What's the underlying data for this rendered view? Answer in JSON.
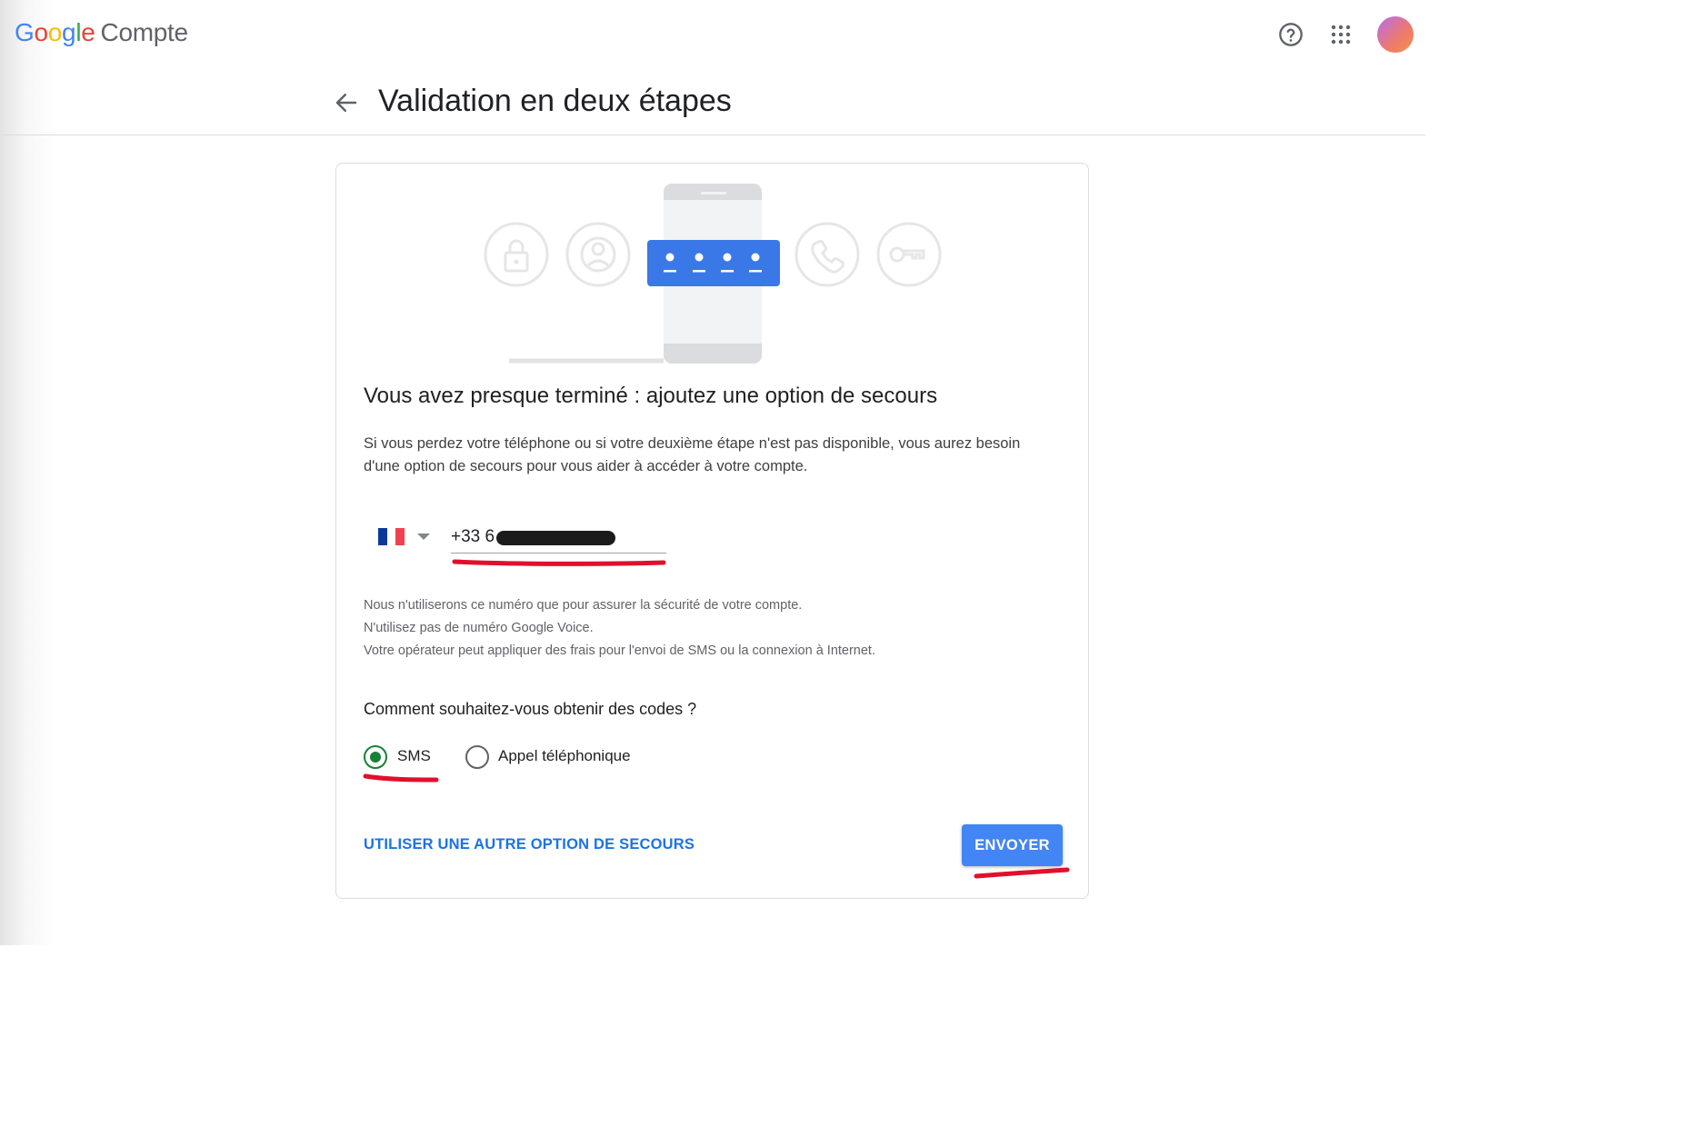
{
  "header": {
    "logo_letters": [
      "G",
      "o",
      "o",
      "g",
      "l",
      "e"
    ],
    "product": "Compte",
    "icons": [
      "help-icon",
      "apps-icon",
      "avatar"
    ]
  },
  "page": {
    "title": "Validation en deux étapes"
  },
  "card": {
    "heading": "Vous avez presque terminé : ajoutez une option de secours",
    "description": "Si vous perdez votre téléphone ou si votre deuxième étape n'est pas disponible, vous aurez besoin d'une option de secours pour vous aider à accéder à votre compte.",
    "phone": {
      "country": "France",
      "prefix": "+33 6",
      "colors": [
        "#0a3a99",
        "#ffffff",
        "#ef4150"
      ]
    },
    "notes": [
      "Nous n'utiliserons ce numéro que pour assurer la sécurité de votre compte.",
      "N'utilisez pas de numéro Google Voice.",
      "Votre opérateur peut appliquer des frais pour l'envoi de SMS ou la connexion à Internet."
    ],
    "question": "Comment souhaitez-vous obtenir des codes ?",
    "options": [
      {
        "label": "SMS",
        "selected": true
      },
      {
        "label": "Appel téléphonique",
        "selected": false
      }
    ],
    "alt_link": "UTILISER UNE AUTRE OPTION DE SECOURS",
    "send": "ENVOYER"
  },
  "colors": {
    "accent": "#1a73e8",
    "button": "#4285f4",
    "radio": "#188038",
    "annotation": "#e0102d"
  }
}
